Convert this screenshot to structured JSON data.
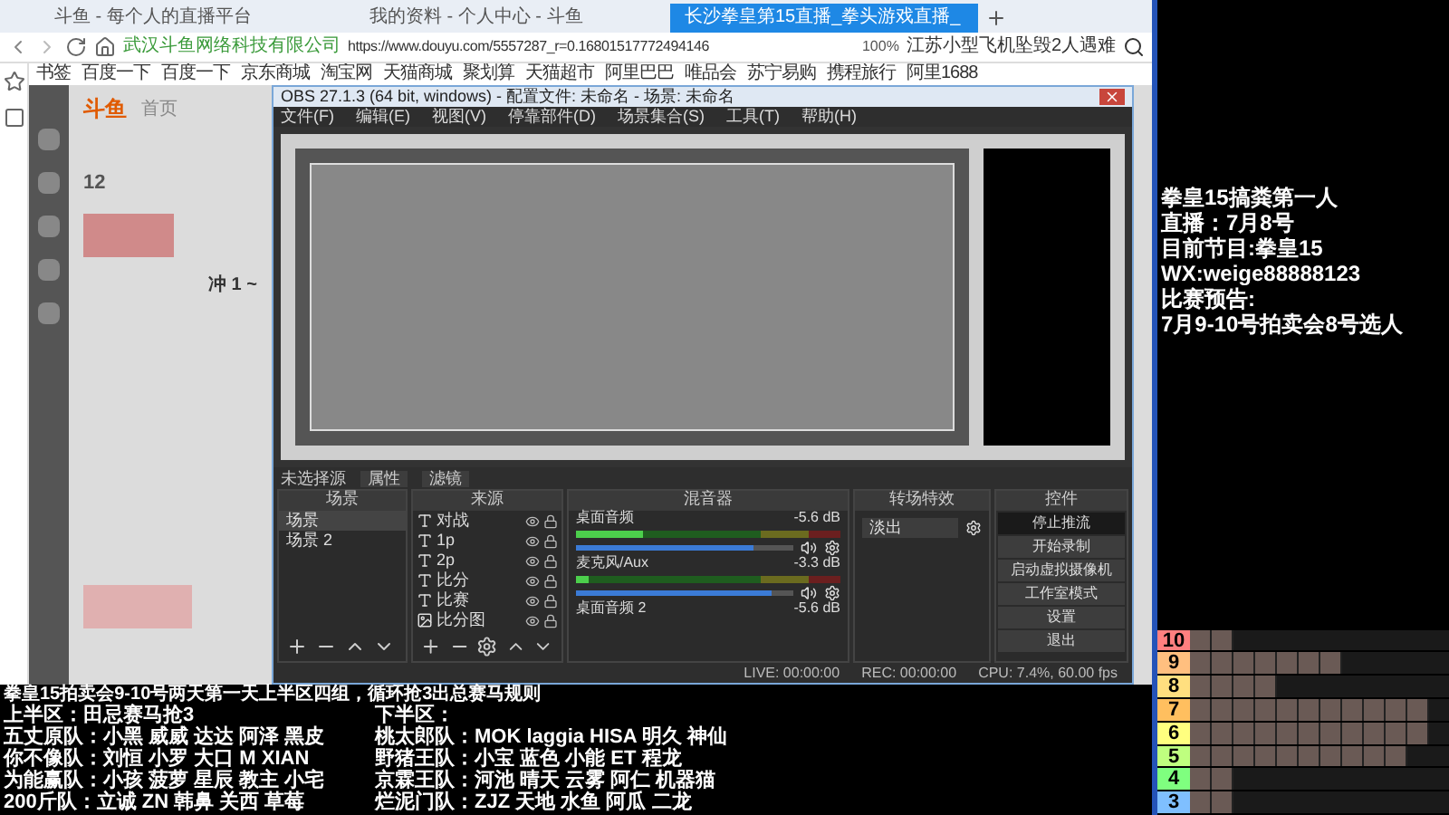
{
  "browser": {
    "tabs": [
      {
        "label": "斗鱼 - 每个人的直播平台",
        "selected": false
      },
      {
        "label": "我的资料 - 个人中心 - 斗鱼",
        "selected": false
      },
      {
        "label": "长沙拳皇第15直播_拳头游戏直播_",
        "selected": true
      }
    ],
    "site_identity": "武汉斗鱼网络科技有限公司",
    "url": "https://www.douyu.com/5557287_r=0.16801517772494146",
    "zoom": "100%",
    "search": "江苏小型飞机坠毁2人遇难",
    "bookmarks": [
      "书签",
      "百度一下",
      "百度一下",
      "京东商城",
      "淘宝网",
      "天猫商城",
      "聚划算",
      "天猫超市",
      "阿里巴巴",
      "唯品会",
      "苏宁易购",
      "携程旅行",
      "阿里1688"
    ]
  },
  "page": {
    "logo": "斗鱼",
    "nav": "首页",
    "badge": "12",
    "rank": "冲 1 ~"
  },
  "obs": {
    "title": "OBS 27.1.3 (64 bit, windows) - 配置文件: 未命名 - 场景: 未命名",
    "menu": [
      "文件(F)",
      "编辑(E)",
      "视图(V)",
      "停靠部件(D)",
      "场景集合(S)",
      "工具(T)",
      "帮助(H)"
    ],
    "source_bar": {
      "label": "未选择源",
      "buttons": [
        "属性",
        "滤镜"
      ]
    },
    "docks": [
      "场景",
      "来源",
      "混音器",
      "转场特效",
      "控件"
    ],
    "scenes": [
      {
        "name": "场景",
        "selected": true
      },
      {
        "name": "场景 2",
        "selected": false
      }
    ],
    "sources": [
      {
        "kind": "text",
        "name": "对战"
      },
      {
        "kind": "text",
        "name": "1p"
      },
      {
        "kind": "text",
        "name": "2p"
      },
      {
        "kind": "text",
        "name": "比分"
      },
      {
        "kind": "text",
        "name": "比赛"
      },
      {
        "kind": "image",
        "name": "比分图"
      }
    ],
    "mixer": [
      {
        "name": "桌面音频",
        "reading": "-5.6 dB",
        "meter": {
          "level": 0.25
        },
        "volume": {
          "level": 0.82
        }
      },
      {
        "name": "麦克风/Aux",
        "reading": "-3.3 dB",
        "meter": {
          "level": 0.05
        },
        "volume": {
          "level": 0.9
        }
      },
      {
        "name": "桌面音频 2",
        "reading": "-5.6 dB"
      }
    ],
    "transition": "淡出",
    "controls": [
      {
        "label": "停止推流",
        "active": true
      },
      {
        "label": "开始录制",
        "active": false
      },
      {
        "label": "启动虚拟摄像机",
        "active": false
      },
      {
        "label": "工作室模式",
        "active": false
      },
      {
        "label": "设置",
        "active": false
      },
      {
        "label": "退出",
        "active": false
      }
    ],
    "status": [
      "LIVE: 00:00:00",
      "REC: 00:00:00",
      "CPU: 7.4%, 60.00 fps"
    ]
  },
  "overlay": [
    "拳皇15搞粪第一人",
    "直播：7月8号",
    "目前节目:拳皇15",
    "WX:weige88888123",
    "比赛预告:",
    "7月9-10号拍卖会8号选人"
  ],
  "schedule": {
    "headline": "拳皇15拍卖会9-10号两天第一天上半区四组，循环抢3出总赛马规则",
    "rows": [
      {
        "left": "上半区：田忌赛马抢3",
        "right": "下半区："
      },
      {
        "left": "五丈原队：小黑 威威 达达 阿泽 黑皮",
        "right": "桃太郎队：MOK laggia HISA 明久 神仙"
      },
      {
        "left": "你不像队：刘恒 小罗 大口 M XIAN",
        "right": "野猪王队：小宝 蓝色 小能 ET 程龙"
      },
      {
        "left": "为能赢队：小孩 菠萝 星辰 教主 小宅",
        "right": "京霖王队：河池 晴天 云雾 阿仁 机器猫"
      },
      {
        "left": "200斤队：立诚 ZN 韩鼻 关西 草莓",
        "right": "烂泥门队：ZJZ 天地 水鱼 阿瓜 二龙"
      }
    ]
  },
  "tier_list": [
    {
      "label": "10",
      "color": "#ff7f7f"
    },
    {
      "label": "9",
      "color": "#ffbf7f"
    },
    {
      "label": "8",
      "color": "#ffdf7f"
    },
    {
      "label": "7",
      "color": "#ffbf5f"
    },
    {
      "label": "6",
      "color": "#ffff7f"
    },
    {
      "label": "5",
      "color": "#bfff7f"
    },
    {
      "label": "4",
      "color": "#7fff7f"
    },
    {
      "label": "3",
      "color": "#7fbfff"
    }
  ]
}
